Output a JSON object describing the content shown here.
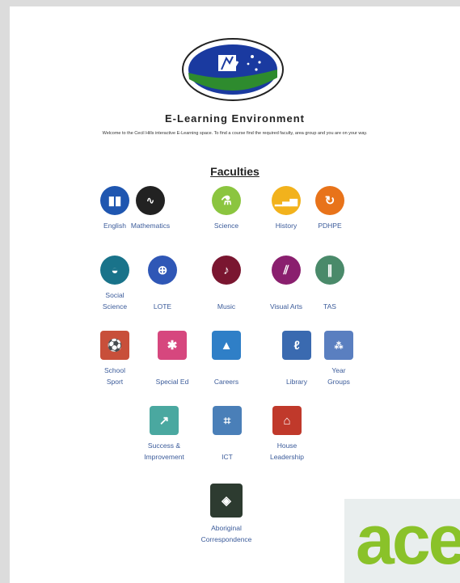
{
  "page": {
    "title": "E-Learning Environment",
    "subtitle": "Welcome to the Cecil Hills interactive E-Learning space. To find a course find the required faculty, area group and you are on your way.",
    "faculties_heading": "Faculties"
  },
  "faculties": [
    {
      "label": "English",
      "icon": "book-icon",
      "color": "#1f56b0"
    },
    {
      "label": "Mathematics",
      "icon": "math-icon",
      "color": "#222222"
    },
    {
      "label": "Science",
      "icon": "science-icon",
      "color": "#8bc53f"
    },
    {
      "label": "History",
      "icon": "history-icon",
      "color": "#f2b21c"
    },
    {
      "label": "PDHPE",
      "icon": "pdhpe-icon",
      "color": "#e8731a"
    },
    {
      "label": "Social Science",
      "icon": "globe-icon",
      "color": "#19738a"
    },
    {
      "label": "LOTE",
      "icon": "languages-icon",
      "color": "#2f57b6"
    },
    {
      "label": "Music",
      "icon": "music-icon",
      "color": "#7a1630"
    },
    {
      "label": "Visual Arts",
      "icon": "visual-arts-icon",
      "color": "#8a1f6e"
    },
    {
      "label": "TAS",
      "icon": "tas-icon",
      "color": "#4a8a6a"
    },
    {
      "label": "School Sport",
      "icon": "sport-icon",
      "color": "#c84f3a"
    },
    {
      "label": "Special Ed",
      "icon": "special-ed-icon",
      "color": "#d6477e"
    },
    {
      "label": "Careers",
      "icon": "careers-icon",
      "color": "#2f7fc7"
    },
    {
      "label": "Library",
      "icon": "library-icon",
      "color": "#3a6ab0"
    },
    {
      "label": "Year Groups",
      "icon": "year-groups-icon",
      "color": "#5a7fc0"
    },
    {
      "label": "Success & Improvement",
      "icon": "success-icon",
      "color": "#4aa8a0"
    },
    {
      "label": "ICT",
      "icon": "ict-icon",
      "color": "#4a7fb8"
    },
    {
      "label": "House Leadership",
      "icon": "house-icon",
      "color": "#c0392b"
    },
    {
      "label": "Aboriginal Correspondence",
      "icon": "aboriginal-icon",
      "color": "#2d3b30"
    }
  ],
  "ad": {
    "brand": "acer",
    "color": "#8ac229"
  }
}
